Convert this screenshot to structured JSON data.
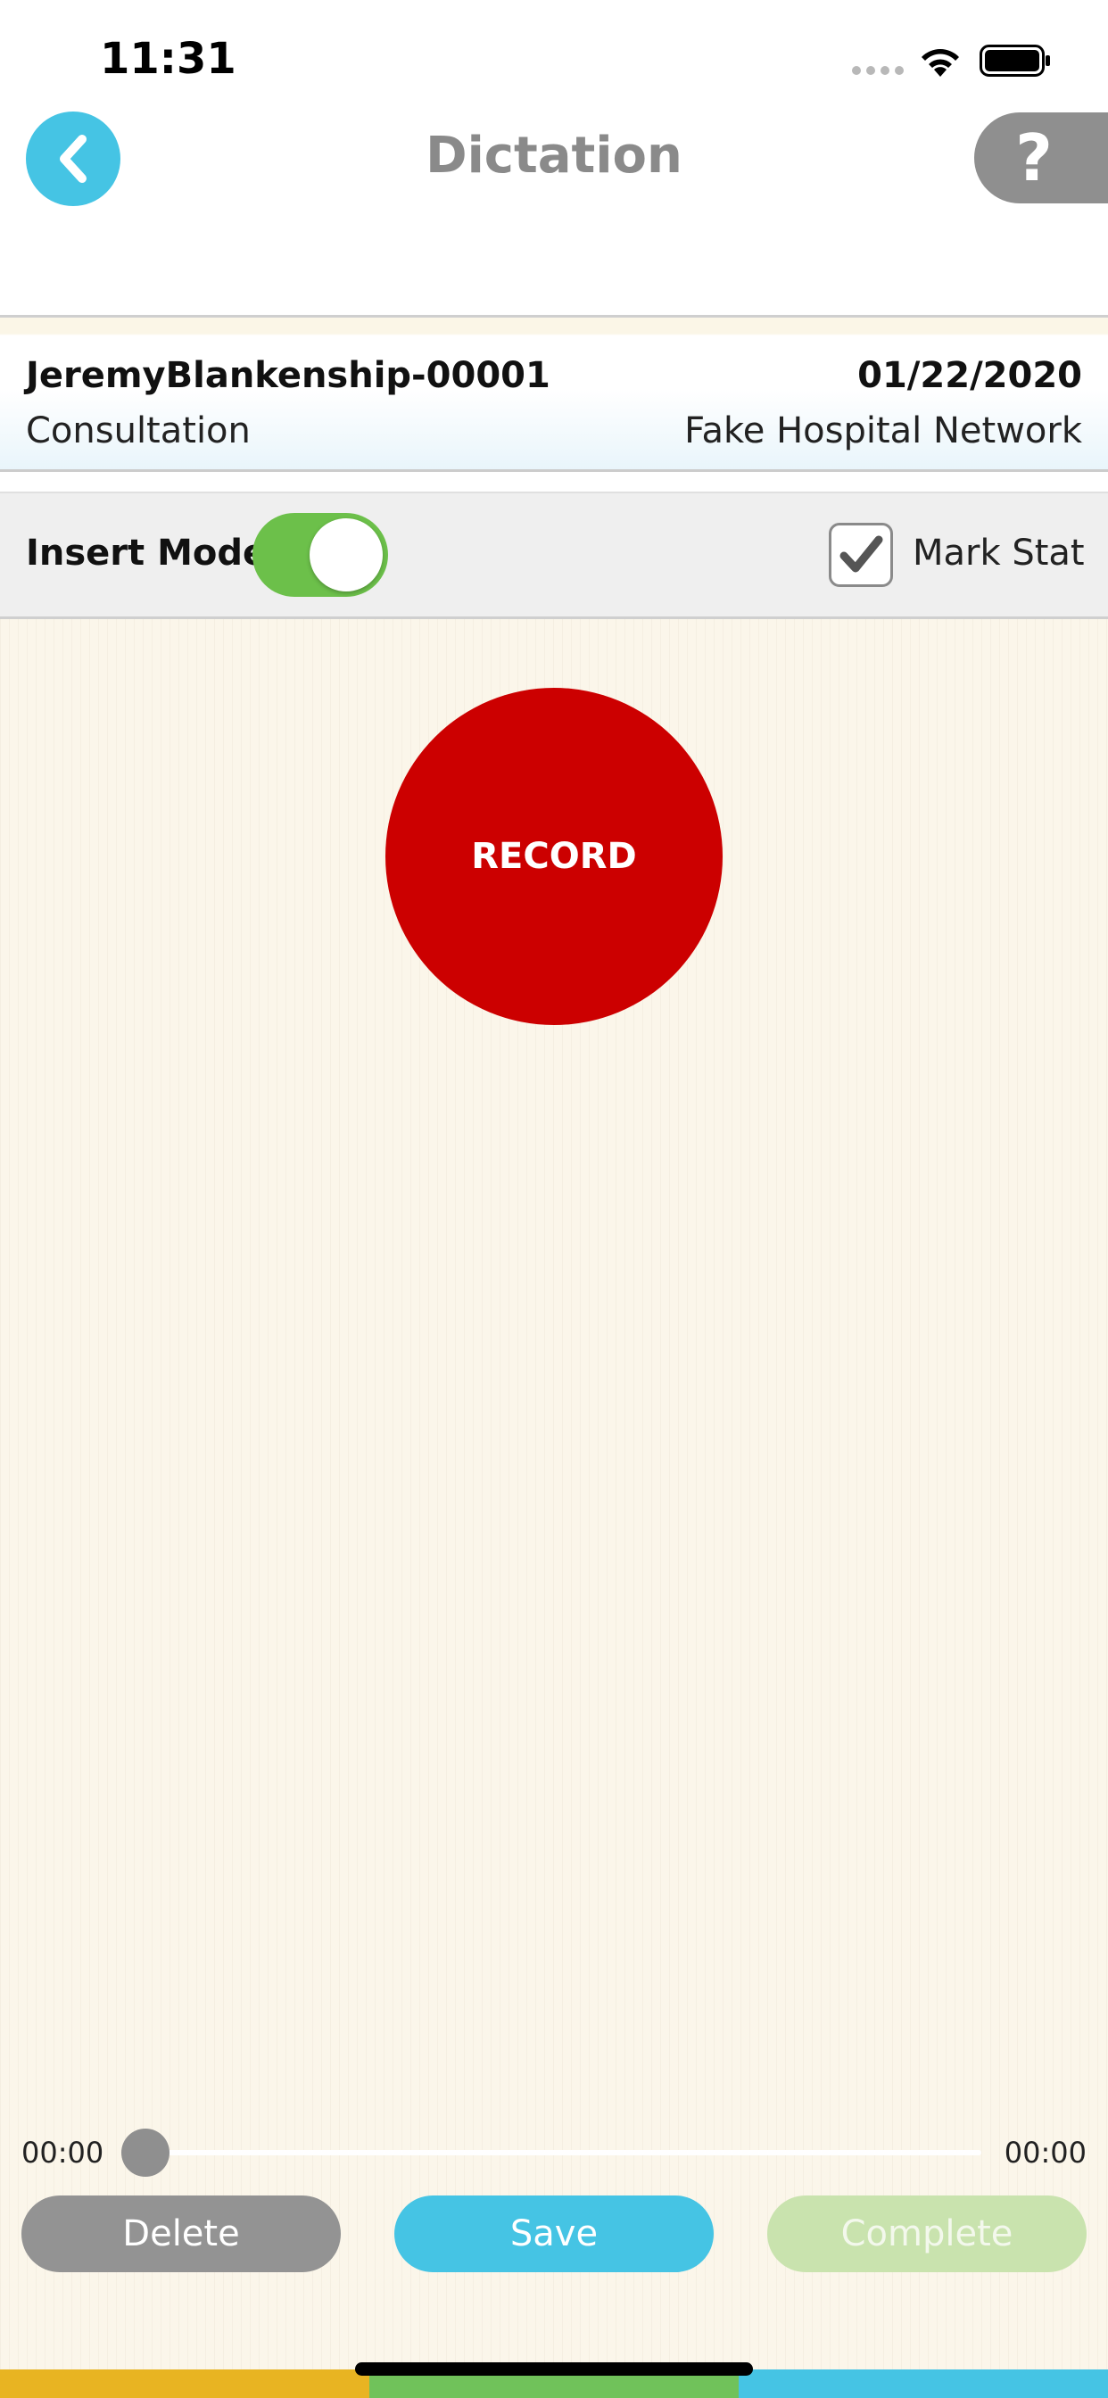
{
  "status_bar": {
    "time": "11:31"
  },
  "nav": {
    "title": "Dictation",
    "back_icon": "chevron-left-icon",
    "help_label": "?"
  },
  "patient": {
    "id": "JeremyBlankenship-00001",
    "date": "01/22/2020",
    "type": "Consultation",
    "facility": "Fake Hospital Network"
  },
  "options": {
    "insert_mode_label": "Insert Mode",
    "insert_mode_on": true,
    "mark_stat_label": "Mark Stat",
    "mark_stat_checked": true
  },
  "record": {
    "label": "RECORD"
  },
  "playback": {
    "current_time": "00:00",
    "total_time": "00:00",
    "progress": 0
  },
  "actions": {
    "delete_label": "Delete",
    "save_label": "Save",
    "complete_label": "Complete"
  },
  "colors": {
    "accent_blue": "#45c4e4",
    "record_red": "#cc0000",
    "toggle_green": "#6cc04a",
    "bar_yellow": "#e8b422",
    "bar_green": "#70c25a",
    "bar_blue": "#45c4e4"
  }
}
